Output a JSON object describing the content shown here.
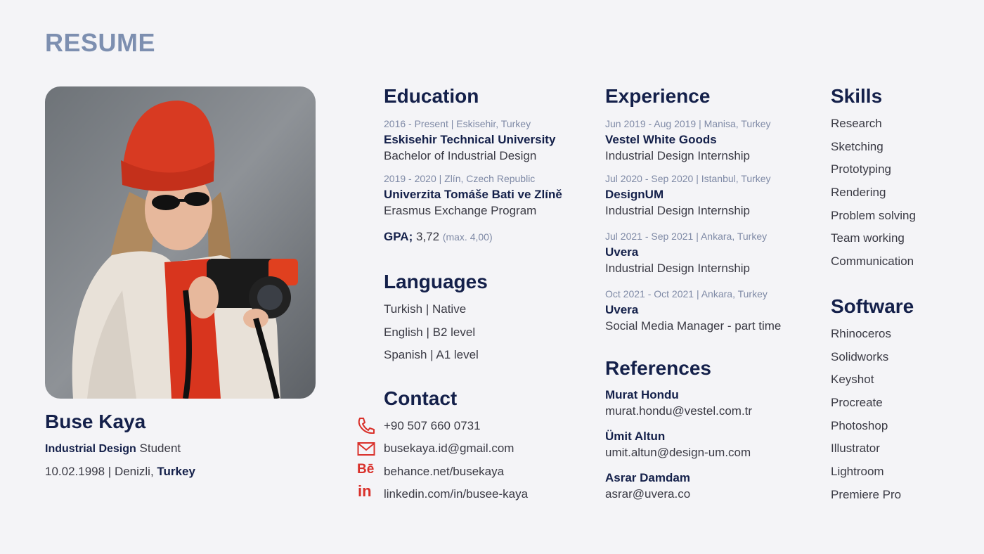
{
  "title": "RESUME",
  "profile": {
    "name": "Buse Kaya",
    "role_bold": "Industrial Design",
    "role_rest": "Student",
    "birth": "10.02.1998 | Denizli,",
    "country": "Turkey"
  },
  "education": {
    "heading": "Education",
    "items": [
      {
        "meta": "2016 - Present | Eskisehir, Turkey",
        "org": "Eskisehir Technical University",
        "desc": "Bachelor of Industrial Design"
      },
      {
        "meta": "2019 - 2020 | Zlín, Czech Republic",
        "org": "Univerzita Tomáše Bati ve Zlíně",
        "desc": "Erasmus Exchange Program"
      }
    ],
    "gpa_label": "GPA;",
    "gpa_value": "3,72",
    "gpa_max": "(max. 4,00)"
  },
  "languages": {
    "heading": "Languages",
    "items": [
      "Turkish | Native",
      "English | B2 level",
      "Spanish | A1 level"
    ]
  },
  "contact": {
    "heading": "Contact",
    "phone": "+90 507 660 0731",
    "email": "busekaya.id@gmail.com",
    "behance": "behance.net/busekaya",
    "linkedin": "linkedin.com/in/busee-kaya",
    "behance_glyph": "Bē",
    "linkedin_glyph": "in"
  },
  "experience": {
    "heading": "Experience",
    "items": [
      {
        "meta": "Jun 2019 - Aug 2019 | Manisa, Turkey",
        "org": "Vestel White Goods",
        "desc": "Industrial Design Internship"
      },
      {
        "meta": "Jul 2020 - Sep 2020 | Istanbul, Turkey",
        "org": "DesignUM",
        "desc": "Industrial Design Internship"
      },
      {
        "meta": "Jul 2021 - Sep 2021 | Ankara, Turkey",
        "org": "Uvera",
        "desc": "Industrial Design Internship"
      },
      {
        "meta": "Oct 2021 - Oct 2021 | Ankara, Turkey",
        "org": "Uvera",
        "desc": "Social Media Manager - part time"
      }
    ]
  },
  "references": {
    "heading": "References",
    "items": [
      {
        "name": "Murat Hondu",
        "email": "murat.hondu@vestel.com.tr"
      },
      {
        "name": "Ümit Altun",
        "email": "umit.altun@design-um.com"
      },
      {
        "name": "Asrar Damdam",
        "email": "asrar@uvera.co"
      }
    ]
  },
  "skills": {
    "heading": "Skills",
    "items": [
      "Research",
      "Sketching",
      "Prototyping",
      "Rendering",
      "Problem solving",
      "Team working",
      "Communication"
    ]
  },
  "software": {
    "heading": "Software",
    "items": [
      "Rhinoceros",
      "Solidworks",
      "Keyshot",
      "Procreate",
      "Photoshop",
      "Illustrator",
      "Lightroom",
      "Premiere Pro"
    ]
  },
  "colors": {
    "navy": "#14204a",
    "title_blue": "#7d8fb0",
    "accent_red": "#d9302a",
    "background": "#f4f4f7"
  }
}
